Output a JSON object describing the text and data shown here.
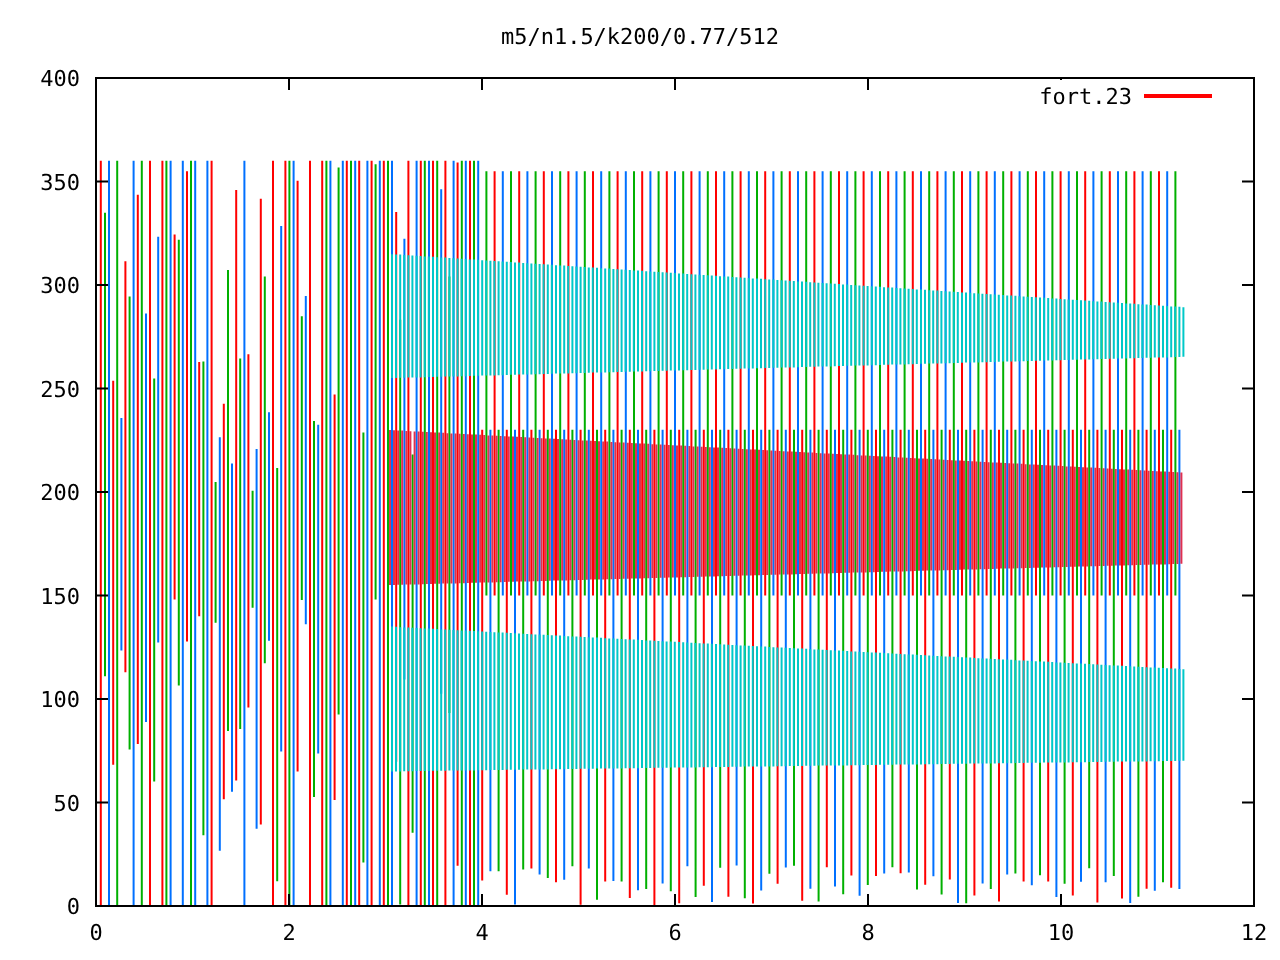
{
  "plot": {
    "title": "m5/n1.5/k200/0.77/512",
    "legend": [
      {
        "label": "fort.23",
        "color": "#ff0000"
      }
    ],
    "xticks": [
      "0",
      "2",
      "4",
      "6",
      "8",
      "10",
      "12"
    ],
    "yticks": [
      "400",
      "350",
      "300",
      "250",
      "200",
      "150",
      "100",
      "50",
      "0"
    ]
  }
}
